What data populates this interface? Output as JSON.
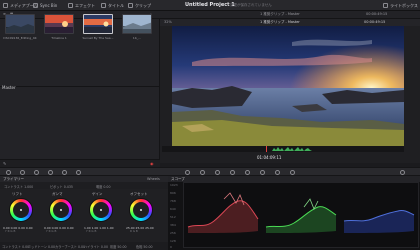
{
  "topbar": {
    "media_pool": "メディアプール",
    "sync_bin": "Sync Bin",
    "effects": "エフェクト",
    "title_tool": "タイトル",
    "clip": "クリップ",
    "project_title": "Untitled Project 1",
    "project_subtitle": "変更が保存されていません",
    "lightbox": "ライトボックス"
  },
  "bar2": {
    "viewer_title": "1 推奨クリップ - Master",
    "timecode": "00:00:49:15"
  },
  "media_pool": {
    "bin_label": "Master",
    "clips": [
      {
        "name": "DSC09136_Editing_4K",
        "sky": "#5a6a8a",
        "ground": "#2a3240"
      },
      {
        "name": "Timeline 1",
        "sky": "#d9533a",
        "ground": "#3b1f28"
      },
      {
        "name": "Sunset By The Sea...",
        "sky": "#e36b44",
        "ground": "#28304a"
      },
      {
        "name": "1b_...",
        "sky": "#9fb5cf",
        "ground": "#4a5868"
      }
    ]
  },
  "viewer": {
    "zoom": "32%",
    "title": "1 推奨クリップ - Master",
    "timecode": "00:00:49:15",
    "scrub_timecode": "01:04:09:11"
  },
  "primaries": {
    "title": "プライマリー",
    "mode": "Wheels",
    "fields": [
      "コントラスト 1.000",
      "ピボット 0.435",
      "明度 0.00"
    ],
    "wheels": [
      {
        "label": "リフト",
        "values": "0.00  0.00  0.00  0.00",
        "channels": "Y  R  G  B"
      },
      {
        "label": "ガンマ",
        "values": "0.00  0.00  0.00  0.00",
        "channels": "Y  R  G  B"
      },
      {
        "label": "ゲイン",
        "values": "1.00  1.00  1.00  1.00",
        "channels": "Y  R  G  B"
      },
      {
        "label": "オフセット",
        "values": "25.00  25.00  25.00",
        "channels": "R  G  B"
      }
    ],
    "footer": [
      "コントラスト 0.00",
      "ミッドトーン 0.00",
      "カラーブースト 0.00",
      "ハイライト 0.00",
      "彩度 50.00",
      "色相 50.00"
    ]
  },
  "scopes": {
    "title": "スコープ",
    "ticks": [
      "1023",
      "896",
      "768",
      "640",
      "512",
      "384",
      "256",
      "128",
      "0"
    ]
  }
}
